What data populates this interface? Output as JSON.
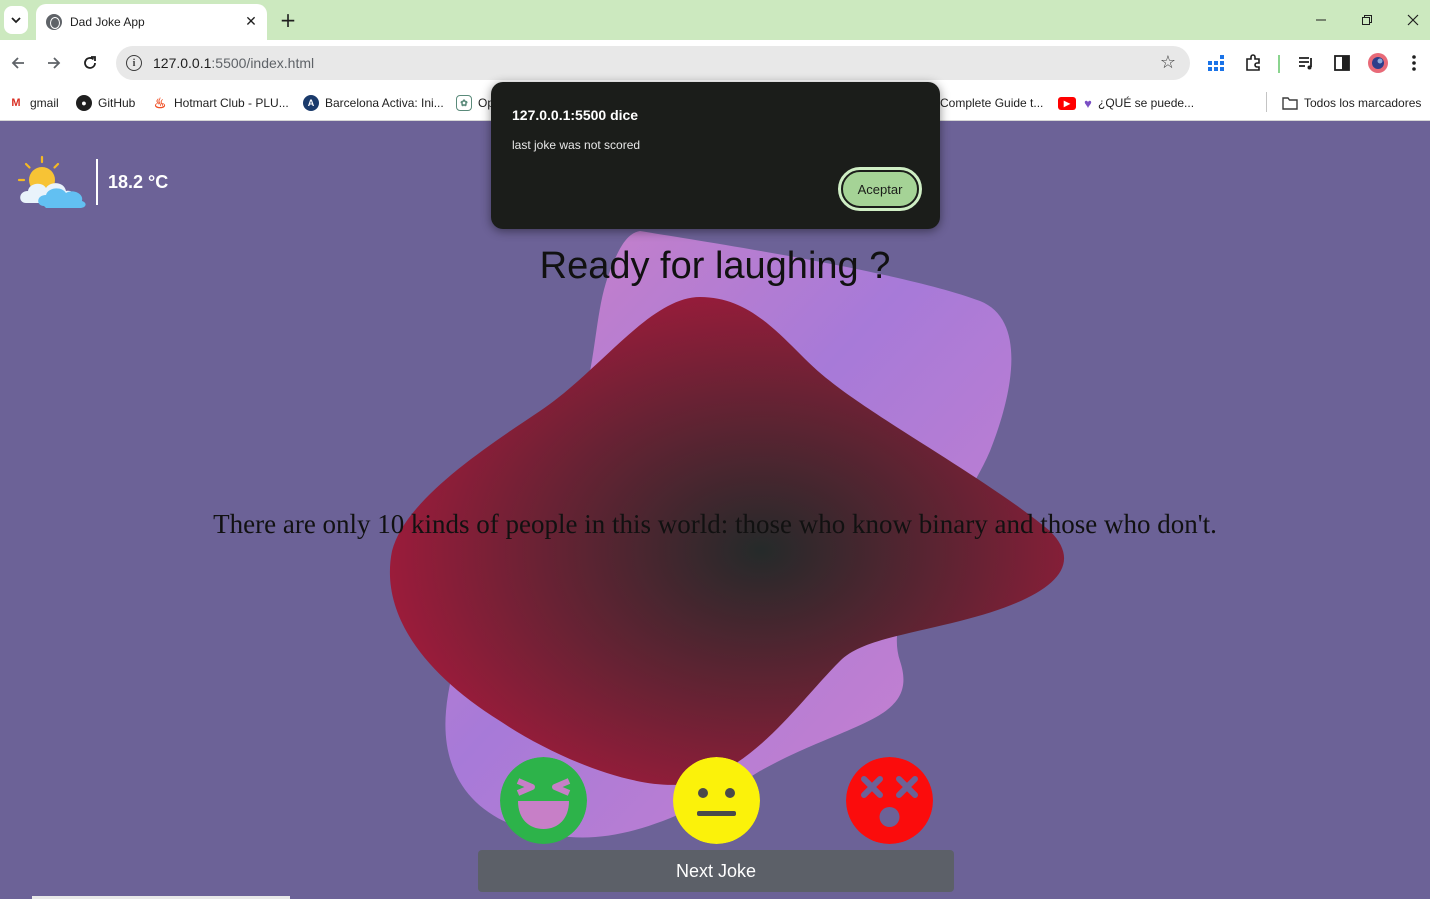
{
  "browser": {
    "tab_title": "Dad Joke App",
    "url_host": "127.0.0.1",
    "url_rest": ":5500/index.html",
    "bookmarks": [
      {
        "label": "gmail",
        "icon": "gmail-icon"
      },
      {
        "label": "GitHub",
        "icon": "github-icon"
      },
      {
        "label": "Hotmart Club - PLU...",
        "icon": "hotmart-icon"
      },
      {
        "label": "Barcelona Activa: Ini...",
        "icon": "barcelona-activa-icon"
      },
      {
        "label": "Op",
        "icon": "openai-icon"
      },
      {
        "label": "Complete Guide t...",
        "icon": "page-icon"
      },
      {
        "label": "¿QUÉ se puede...",
        "icon": "youtube-icon"
      }
    ],
    "all_bookmarks_label": "Todos los marcadores"
  },
  "weather": {
    "temperature": "18.2 °C",
    "icon": "partly-cloudy-icon"
  },
  "main": {
    "title": "Ready for laughing ?",
    "joke": "There are only 10 kinds of people in this world: those who know binary and those who don't.",
    "ratings": [
      {
        "name": "laughing-emoji",
        "color": "#2db34a"
      },
      {
        "name": "neutral-emoji",
        "color": "#fbf20a"
      },
      {
        "name": "dizzy-emoji",
        "color": "#fb0c0c"
      }
    ],
    "next_button": "Next Joke"
  },
  "dialog": {
    "title": "127.0.0.1:5500 dice",
    "message": "last joke was not scored",
    "ok_button": "Aceptar"
  },
  "colors": {
    "tabstrip": "#cce9bf",
    "page_background": "#6c6297",
    "dialog_background": "#1b1d1a",
    "dialog_button": "#a5d396"
  }
}
